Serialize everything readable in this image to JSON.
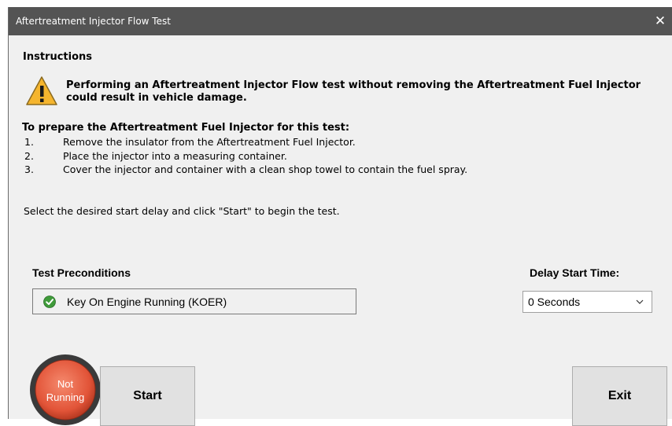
{
  "window": {
    "title": "Aftertreatment Injector Flow Test",
    "close_label": "✕"
  },
  "instructions": {
    "heading": "Instructions",
    "warning_icon": "warning-triangle-icon",
    "warning_text": "Performing an Aftertreatment Injector Flow test without removing the Aftertreatment Fuel Injector could result in vehicle damage.",
    "prep_heading": "To prepare the Aftertreatment Fuel Injector for this test:",
    "steps": [
      {
        "num": "1.",
        "text": "Remove the insulator from the Aftertreatment Fuel Injector."
      },
      {
        "num": "2.",
        "text": "Place the injector into a measuring container."
      },
      {
        "num": "3.",
        "text": "Cover the injector and container with a clean shop towel to contain the fuel spray."
      }
    ],
    "select_text": "Select the desired start delay and click \"Start\" to begin the test."
  },
  "preconditions": {
    "label": "Test Preconditions",
    "items": [
      {
        "icon": "green-check-icon",
        "text": "Key On Engine Running (KOER)"
      }
    ]
  },
  "delay": {
    "label": "Delay Start Time:",
    "selected": "0 Seconds"
  },
  "status": {
    "line1": "Not",
    "line2": "Running",
    "color": "#e8604a"
  },
  "buttons": {
    "start": "Start",
    "exit": "Exit"
  }
}
